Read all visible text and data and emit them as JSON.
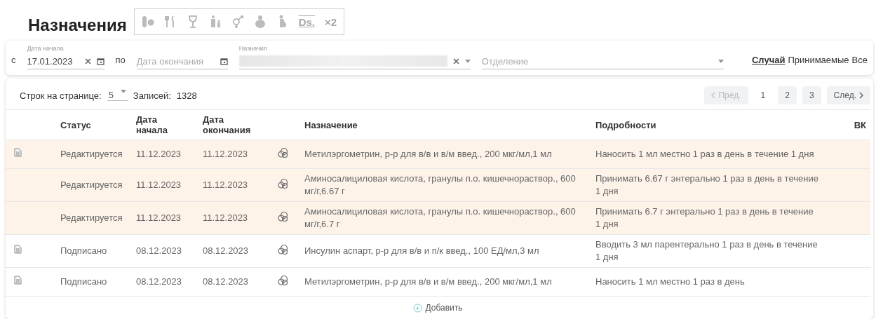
{
  "title": "Назначения",
  "toolbar": [
    {
      "kind": "pills"
    },
    {
      "kind": "cutlery"
    },
    {
      "kind": "glass"
    },
    {
      "kind": "family"
    },
    {
      "kind": "gender"
    },
    {
      "kind": "mother"
    },
    {
      "kind": "pregnant"
    },
    {
      "kind": "text",
      "label": "Ds."
    },
    {
      "kind": "text",
      "label": "×2"
    }
  ],
  "filters": {
    "start_date": {
      "label": "Дата начала",
      "prefix": "с",
      "value": "17.01.2023"
    },
    "end_date": {
      "prefix": "по",
      "placeholder": "Дата окончания"
    },
    "prescriber": {
      "label": "Назначил",
      "redacted": true
    },
    "department": {
      "placeholder": "Отделение"
    },
    "scope_options": [
      {
        "label": "Случай",
        "selected": true
      },
      {
        "label": "Принимаемые",
        "selected": false
      },
      {
        "label": "Все",
        "selected": false
      }
    ]
  },
  "table": {
    "page_size_label": "Строк на странице:",
    "page_size": "5",
    "records_label": "Записей:",
    "records": "1328",
    "pagination": {
      "prev": {
        "label": "Пред.",
        "disabled": true
      },
      "pages": [
        {
          "label": "1",
          "selected": true
        },
        {
          "label": "2",
          "selected": false
        },
        {
          "label": "3",
          "selected": false
        }
      ],
      "next": {
        "label": "След.",
        "disabled": false
      }
    },
    "columns": [
      "Статус",
      "Дата начала",
      "Дата окончания",
      "Назначение",
      "Подробности",
      "ВК"
    ],
    "rows": [
      {
        "document": true,
        "highlighted": true,
        "status": "Редактируется",
        "start": "11.12.2023",
        "end": "11.12.2023",
        "prescription": "Метилэргометрин, р-р для в/в и в/м введ., 200 мкг/мл,1 мл",
        "details": "Наносить 1 мл местно 1 раз в день в течение 1 дня"
      },
      {
        "document": false,
        "highlighted": true,
        "status": "Редактируется",
        "start": "11.12.2023",
        "end": "11.12.2023",
        "prescription": "Аминосалициловая кислота, гранулы п.о. кишечнораствор., 600 мг/г,6.67 г",
        "details": "Принимать 6.67 г энтерально 1 раз в день в течение 1 дня"
      },
      {
        "document": false,
        "highlighted": true,
        "status": "Редактируется",
        "start": "11.12.2023",
        "end": "11.12.2023",
        "prescription": "Аминосалициловая кислота, гранулы п.о. кишечнораствор., 600 мг/г,6.7 г",
        "details": "Принимать 6.7 г энтерально 1 раз в день в течение 1 дня"
      },
      {
        "document": true,
        "highlighted": false,
        "status": "Подписано",
        "start": "08.12.2023",
        "end": "08.12.2023",
        "prescription": "Инсулин аспарт, р-р для в/в и п/к введ., 100 ЕД/мл,3 мл",
        "details": "Вводить 3 мл парентерально 1 раз в день в течение 1 дня"
      },
      {
        "document": true,
        "highlighted": false,
        "status": "Подписано",
        "start": "08.12.2023",
        "end": "08.12.2023",
        "prescription": "Метилэргометрин, р-р для в/в и в/м введ., 200 мкг/мл,1 мл",
        "details": "Наносить 1 мл местно 1 раз в день"
      }
    ],
    "add_label": "Добавить"
  }
}
